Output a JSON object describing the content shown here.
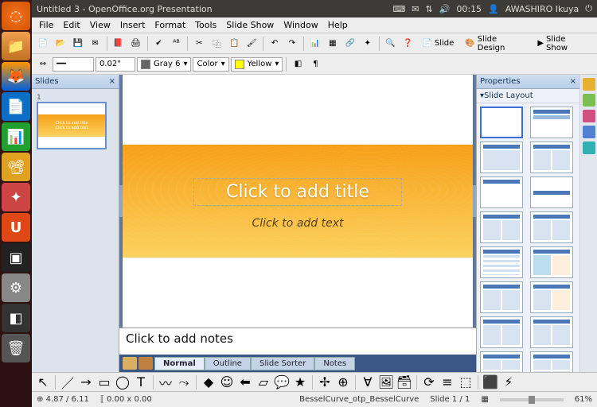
{
  "sysbar": {
    "window_title": "Untitled 3 - OpenOffice.org Presentation",
    "time": "00:15",
    "user": "AWASHIRO Ikuya"
  },
  "menubar": [
    "File",
    "Edit",
    "View",
    "Insert",
    "Format",
    "Tools",
    "Slide Show",
    "Window",
    "Help"
  ],
  "toolbar2": {
    "size": "0.02\"",
    "line_color_label": "Gray 6",
    "fill_label": "Color",
    "fill_color_label": "Yellow"
  },
  "toolbar_right": {
    "slide": "Slide",
    "slide_design": "Slide Design",
    "slide_show": "Slide Show"
  },
  "slides_panel": {
    "title": "Slides",
    "num": "1"
  },
  "slide": {
    "title_placeholder": "Click to add title",
    "subtitle_placeholder": "Click to add text",
    "notes_placeholder": "Click to add notes",
    "thumb_title": "Click to add title",
    "thumb_sub": "Click to add text"
  },
  "view_tabs": [
    "Normal",
    "Outline",
    "Slide Sorter",
    "Notes"
  ],
  "properties": {
    "title": "Properties",
    "subtitle": "Slide Layout"
  },
  "status": {
    "coords": "4.87 / 6.11",
    "size": "0.00 x 0.00",
    "template": "BesselCurve_otp_BesselCurve",
    "slide": "Slide 1 / 1",
    "zoom": "61%"
  },
  "colors": {
    "accent": "#3a6fd8",
    "slide_gradient_from": "#f7a01a",
    "slide_gradient_to": "#fbd25e",
    "gray6": "#666666",
    "yellow": "#ffff00"
  }
}
